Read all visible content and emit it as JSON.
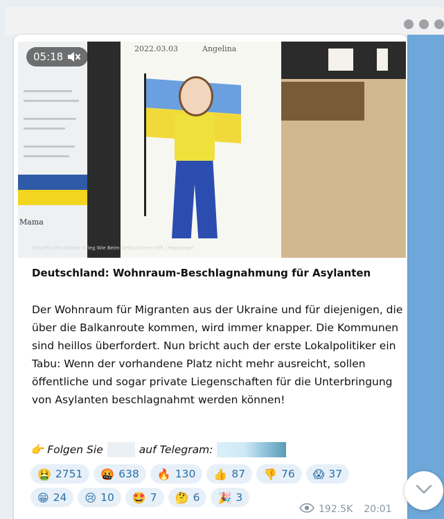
{
  "video": {
    "duration": "05:18",
    "drawing_date": "2022.03.03",
    "drawing_name": "Angelina",
    "poster_label": "Mama",
    "credit": "Krise/Flucht-Ukraine-Krieg Wie Beim Geflüchteten hilft | Reportage"
  },
  "post": {
    "title": "Deutschland: Wohnraum-Beschlagnahmung für Asylanten",
    "body": "Der Wohnraum für Migranten aus der Ukraine und für diejenigen, die über die Balkanroute kommen, wird immer knapper. Die Kommunen sind heillos überfordert. Nun bricht auch der erste Lokalpolitiker ein Tabu: Wenn der vorhandene Platz nicht mehr ausreicht, sollen öffentliche und sogar private Liegenschaften für die Unterbringung von Asylanten beschlagnahmt werden können!",
    "follow_prefix": "👉 Folgen Sie",
    "follow_suffix": "auf Telegram:"
  },
  "reactions": [
    {
      "emoji": "🤮",
      "count": "2751"
    },
    {
      "emoji": "🤬",
      "count": "638"
    },
    {
      "emoji": "🔥",
      "count": "130"
    },
    {
      "emoji": "👍",
      "count": "87"
    },
    {
      "emoji": "👎",
      "count": "76"
    },
    {
      "emoji": "😱",
      "count": "37"
    },
    {
      "emoji": "😁",
      "count": "24"
    },
    {
      "emoji": "😢",
      "count": "10"
    },
    {
      "emoji": "🤩",
      "count": "7"
    },
    {
      "emoji": "🤔",
      "count": "6"
    },
    {
      "emoji": "🎉",
      "count": "3"
    }
  ],
  "meta": {
    "views": "192.5K",
    "time": "20:01"
  },
  "colors": {
    "accent_blue": "#6ea8db",
    "chip_bg": "#e7f0f8",
    "chip_text": "#2a6fa6"
  }
}
